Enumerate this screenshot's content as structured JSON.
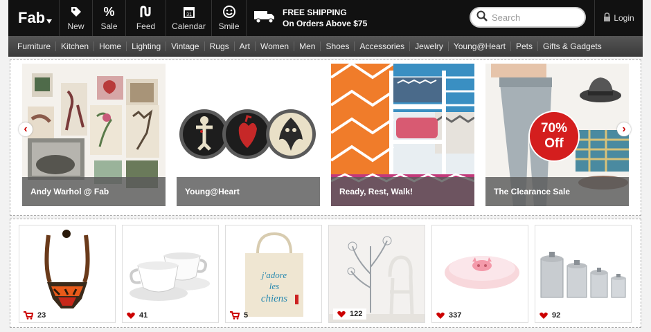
{
  "brand": {
    "logo": "Fab"
  },
  "topnav": [
    {
      "key": "new",
      "label": "New",
      "icon": "tag-icon"
    },
    {
      "key": "sale",
      "label": "Sale",
      "icon": "percent-icon"
    },
    {
      "key": "feed",
      "label": "Feed",
      "icon": "feed-icon"
    },
    {
      "key": "calendar",
      "label": "Calendar",
      "icon": "calendar-icon"
    },
    {
      "key": "smile",
      "label": "Smile",
      "icon": "smile-icon"
    }
  ],
  "shipping": {
    "line1": "FREE SHIPPING",
    "line2": "On Orders Above $75",
    "icon": "truck-icon"
  },
  "search": {
    "placeholder": "Search",
    "value": ""
  },
  "login": {
    "label": "Login",
    "icon": "lock-icon"
  },
  "categories": [
    "Furniture",
    "Kitchen",
    "Home",
    "Lighting",
    "Vintage",
    "Rugs",
    "Art",
    "Women",
    "Men",
    "Shoes",
    "Accessories",
    "Jewelry",
    "Young@Heart",
    "Pets",
    "Gifts & Gadgets"
  ],
  "hero_tiles": [
    {
      "caption": "Andy Warhol @ Fab"
    },
    {
      "caption": "Young@Heart"
    },
    {
      "caption": "Ready, Rest, Walk!"
    },
    {
      "caption": "The Clearance Sale",
      "badge": {
        "line1": "70%",
        "line2": "Off"
      }
    }
  ],
  "products": [
    {
      "count": "23",
      "icon": "cart-icon"
    },
    {
      "count": "41",
      "icon": "heart-icon"
    },
    {
      "count": "5",
      "icon": "cart-icon"
    },
    {
      "count": "122",
      "icon": "heart-icon"
    },
    {
      "count": "337",
      "icon": "heart-icon"
    },
    {
      "count": "92",
      "icon": "heart-icon"
    }
  ],
  "product_text": {
    "tote_line1": "j'adore",
    "tote_line2": "les",
    "tote_line3": "chiens"
  },
  "colors": {
    "accent": "#cc0000",
    "topbar": "#111111",
    "catbar": "#444444"
  }
}
